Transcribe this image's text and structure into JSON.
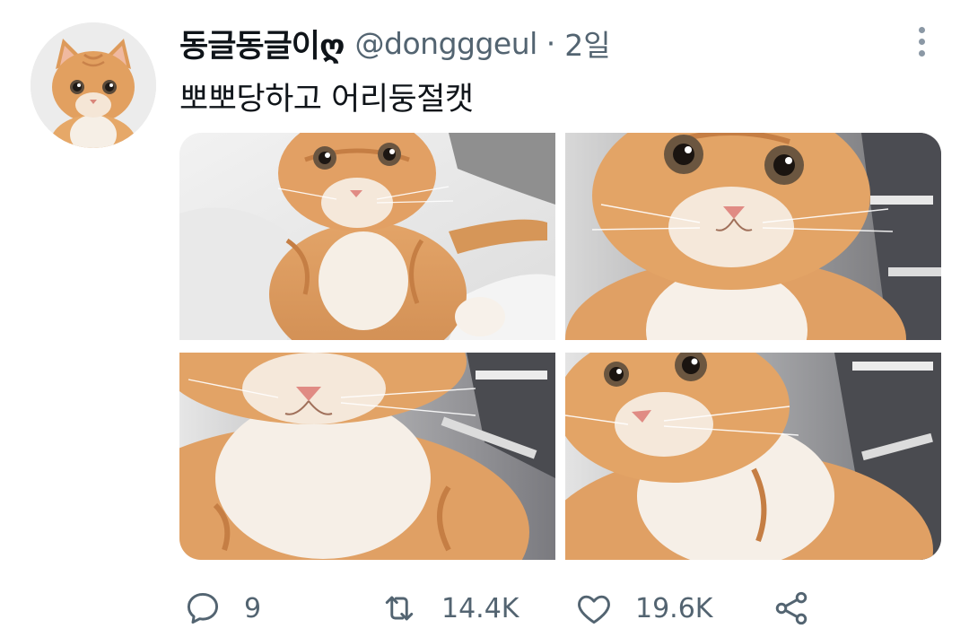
{
  "tweet": {
    "author": {
      "display_name": "동글동글이ღ",
      "handle": "@dongggeul",
      "separator": "·",
      "timestamp": "2일"
    },
    "text": "뽀뽀당하고 어리둥절캣",
    "media": [
      {
        "alt": "kitten-photo-1"
      },
      {
        "alt": "kitten-photo-2"
      },
      {
        "alt": "kitten-photo-3"
      },
      {
        "alt": "kitten-photo-4"
      }
    ],
    "actions": {
      "reply": {
        "icon": "reply-icon",
        "count": "9"
      },
      "retweet": {
        "icon": "retweet-icon",
        "count": "14.4K"
      },
      "like": {
        "icon": "heart-icon",
        "count": "19.6K"
      },
      "share": {
        "icon": "share-icon"
      }
    },
    "more_icon": "more-vertical-icon"
  },
  "colors": {
    "text_primary": "#0f1419",
    "text_secondary": "#536471",
    "kitten_orange": "#e0a066",
    "kitten_white": "#f7f2ec",
    "background": "#ffffff"
  }
}
